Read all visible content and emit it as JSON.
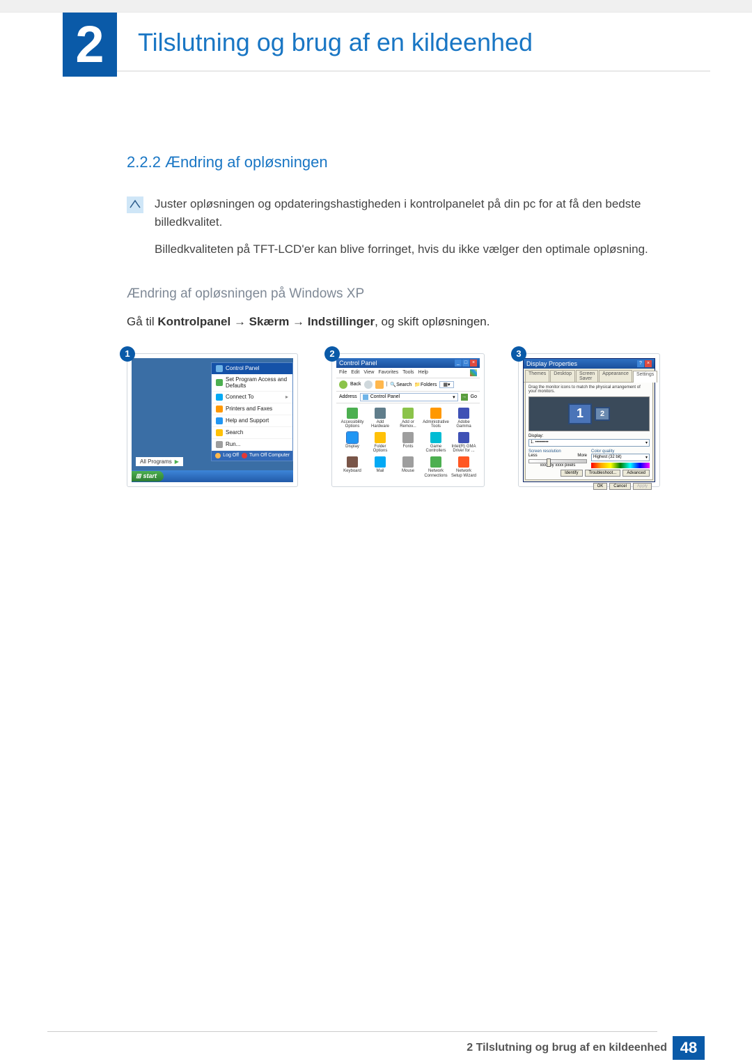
{
  "header": {
    "chapter_number": "2",
    "chapter_title": "Tilslutning og brug af en kildeenhed"
  },
  "section": {
    "number_title": "2.2.2 Ændring af opløsningen",
    "note_line1": "Juster opløsningen og opdateringshastigheden i kontrolpanelet på din pc for at få den bedste billedkvalitet.",
    "note_line2": "Billedkvaliteten på TFT-LCD'er kan blive forringet, hvis du ikke vælger den optimale opløsning."
  },
  "subsection": {
    "title": "Ændring af opløsningen på Windows XP",
    "instr_prefix": "Gå til ",
    "instr_bold": "Kontrolpanel → Skærm → Indstillinger",
    "instr_suffix": ", og skift opløsningen."
  },
  "shot1": {
    "badge": "1",
    "control_panel": "Control Panel",
    "set_program": "Set Program Access and Defaults",
    "connect_to": "Connect To",
    "printers_faxes": "Printers and Faxes",
    "help_support": "Help and Support",
    "search": "Search",
    "run": "Run...",
    "all_programs": "All Programs",
    "log_off": "Log Off",
    "turn_off": "Turn Off Computer",
    "start": "start"
  },
  "shot2": {
    "badge": "2",
    "title": "Control Panel",
    "menu": [
      "File",
      "Edit",
      "View",
      "Favorites",
      "Tools",
      "Help"
    ],
    "back": "Back",
    "search": "Search",
    "folders": "Folders",
    "address_label": "Address",
    "address_value": "Control Panel",
    "go": "Go",
    "icons": [
      {
        "label": "Accessibility Options",
        "color": "#4caf50"
      },
      {
        "label": "Add Hardware",
        "color": "#607d8b"
      },
      {
        "label": "Add or Remov...",
        "color": "#8bc34a"
      },
      {
        "label": "Administrative Tools",
        "color": "#ff9800"
      },
      {
        "label": "Adobe Gamma",
        "color": "#3f51b5"
      },
      {
        "label": "Display",
        "color": "#2196f3",
        "highlight": true
      },
      {
        "label": "Folder Options",
        "color": "#ffc107"
      },
      {
        "label": "Fonts",
        "color": "#9e9e9e"
      },
      {
        "label": "Game Controllers",
        "color": "#00bcd4"
      },
      {
        "label": "Intel(R) GMA Driver for ...",
        "color": "#3f51b5"
      },
      {
        "label": "Keyboard",
        "color": "#795548"
      },
      {
        "label": "Mail",
        "color": "#03a9f4"
      },
      {
        "label": "Mouse",
        "color": "#9e9e9e"
      },
      {
        "label": "Network Connections",
        "color": "#4caf50"
      },
      {
        "label": "Network Setup Wizard",
        "color": "#ff5722"
      }
    ]
  },
  "shot3": {
    "badge": "3",
    "title": "Display Properties",
    "tabs": [
      "Themes",
      "Desktop",
      "Screen Saver",
      "Appearance",
      "Settings"
    ],
    "active_tab": 4,
    "instr": "Drag the monitor icons to match the physical arrangement of your monitors.",
    "mon1": "1",
    "mon2": "2",
    "display_label": "Display:",
    "display_value": "1. •••••••••",
    "res_label": "Screen resolution",
    "less": "Less",
    "more": "More",
    "res_value": "xxxx by xxxx pixels",
    "color_label": "Color quality",
    "color_value": "Highest (32 bit)",
    "btn_identify": "Identify",
    "btn_troubleshoot": "Troubleshoot...",
    "btn_advanced": "Advanced",
    "btn_ok": "OK",
    "btn_cancel": "Cancel",
    "btn_apply": "Apply"
  },
  "footer": {
    "text": "2 Tilslutning og brug af en kildeenhed",
    "page": "48"
  }
}
